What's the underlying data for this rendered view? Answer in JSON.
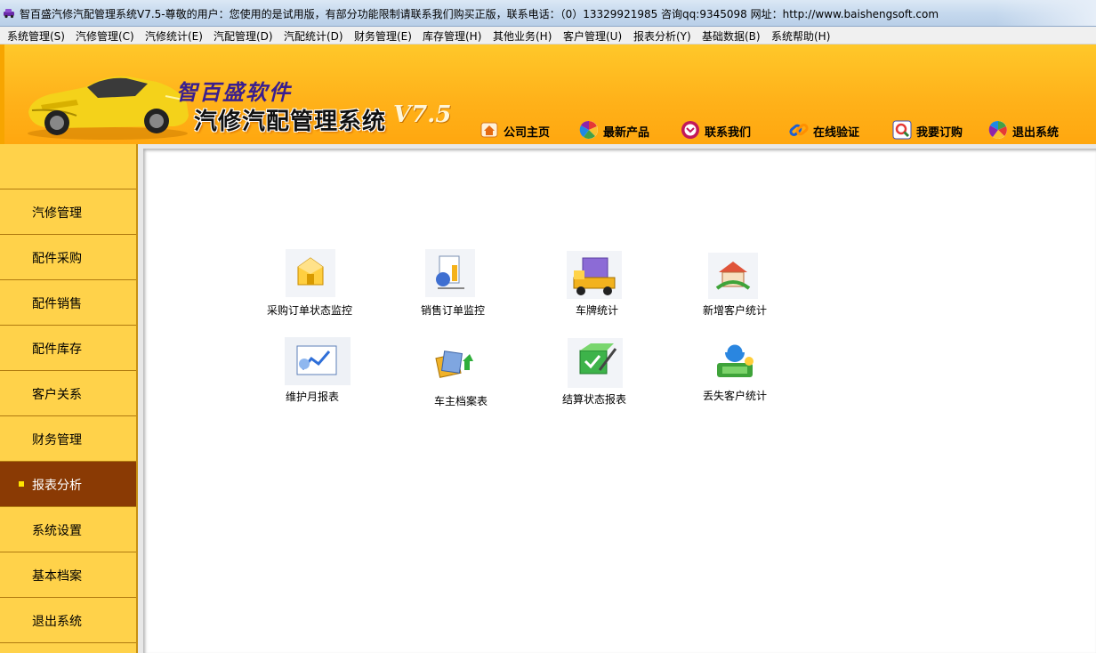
{
  "window": {
    "title": "智百盛汽修汽配管理系统V7.5-尊敬的用户：您使用的是试用版，有部分功能限制请联系我们购买正版，联系电话：（0）13329921985  咨询qq:9345098  网址：http://www.baishengsoft.com"
  },
  "menu": [
    "系统管理(S)",
    "汽修管理(C)",
    "汽修统计(E)",
    "汽配管理(D)",
    "汽配统计(D)",
    "财务管理(E)",
    "库存管理(H)",
    "其他业务(H)",
    "客户管理(U)",
    "报表分析(Y)",
    "基础数据(B)",
    "系统帮助(H)"
  ],
  "header": {
    "brand_sub": "智百盛软件",
    "brand_main": "汽修汽配管理系统",
    "brand_version": "V7.5",
    "nav": [
      {
        "label": "公司主页",
        "icon": "house-icon"
      },
      {
        "label": "最新产品",
        "icon": "color-wheel-icon"
      },
      {
        "label": "联系我们",
        "icon": "contact-icon"
      },
      {
        "label": "在线验证",
        "icon": "link-icon"
      },
      {
        "label": "我要订购",
        "icon": "search-order-icon"
      },
      {
        "label": "退出系统",
        "icon": "exit-wheel-icon"
      }
    ]
  },
  "sidebar": {
    "items": [
      {
        "label": "汽修管理"
      },
      {
        "label": "配件采购"
      },
      {
        "label": "配件销售"
      },
      {
        "label": "配件库存"
      },
      {
        "label": "客户关系"
      },
      {
        "label": "财务管理"
      },
      {
        "label": "报表分析",
        "active": true
      },
      {
        "label": "系统设置"
      },
      {
        "label": "基本档案"
      },
      {
        "label": "退出系统"
      }
    ]
  },
  "reports": [
    {
      "label": "采购订单状态监控",
      "icon": "purchase-order-icon"
    },
    {
      "label": "销售订单监控",
      "icon": "sales-order-icon"
    },
    {
      "label": "车牌统计",
      "icon": "truck-icon"
    },
    {
      "label": "新增客户统计",
      "icon": "new-customer-icon"
    },
    {
      "label": "维护月报表",
      "icon": "monthly-report-icon"
    },
    {
      "label": "车主档案表",
      "icon": "owner-archive-icon"
    },
    {
      "label": "结算状态报表",
      "icon": "settlement-icon"
    },
    {
      "label": "丢失客户统计",
      "icon": "lost-customer-icon"
    }
  ],
  "colors": {
    "header_top": "#ffc82a",
    "header_bottom": "#ffa70f",
    "sidebar": "#ffd24a",
    "sidebar_active": "#8a3a04"
  }
}
